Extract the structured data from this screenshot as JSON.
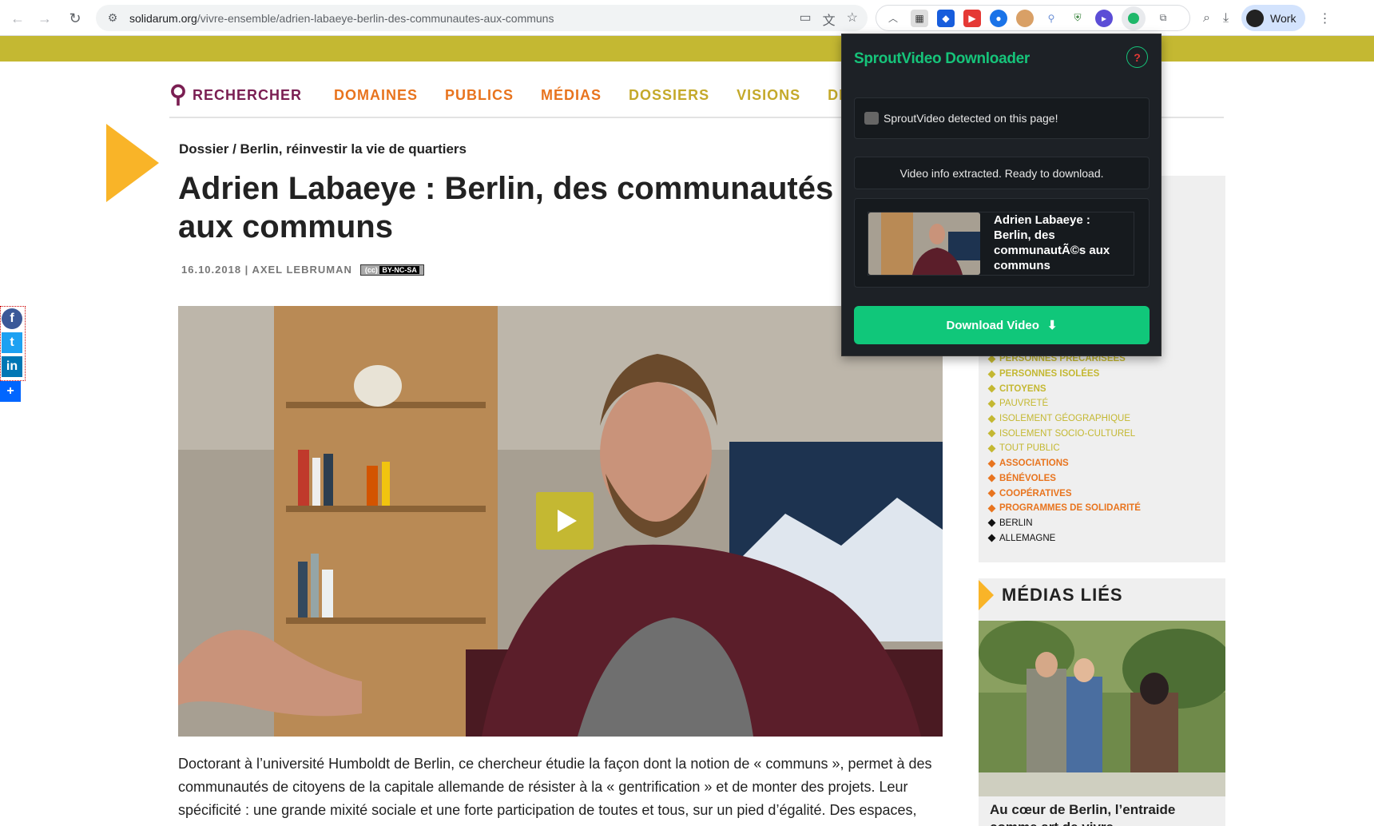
{
  "browser": {
    "url_host": "solidarum.org",
    "url_path": "/vivre-ensemble/adrien-labaeye-berlin-des-communautes-aux-communs",
    "profile_label": "Work"
  },
  "nav": {
    "search_label": "RECHERCHER",
    "items": [
      {
        "label": "DOMAINES",
        "color": "#e8741e"
      },
      {
        "label": "PUBLICS",
        "color": "#e8741e"
      },
      {
        "label": "MÉDIAS",
        "color": "#e8741e"
      },
      {
        "label": "DOSSIERS",
        "color": "#c4a92a"
      },
      {
        "label": "VISIONS",
        "color": "#c4a92a"
      },
      {
        "label": "DISCU",
        "color": "#c4a92a"
      }
    ]
  },
  "article": {
    "breadcrumb": "Dossier / Berlin, réinvestir la vie de quartiers",
    "title": "Adrien Labaeye : Berlin, des communautés aux communs",
    "meta": "16.10.2018 | AXEL LEBRUMAN",
    "license": "BY-NC-SA",
    "paragraph": "Doctorant à l’université Humboldt de Berlin, ce chercheur étudie la façon dont la notion de  « communs », permet à des communautés de citoyens de la capitale allemande de résister à la « gentrification » et de monter des projets. Leur spécificité : une grande mixité sociale et une forte participation de toutes et tous, sur un pied d’égalité. Des espaces,"
  },
  "sidebar": {
    "tags": [
      {
        "label": "PERSONNES PRÉCARISÉES",
        "color": "#c4b832",
        "bold": true
      },
      {
        "label": "PERSONNES ISOLÉES",
        "color": "#c4b832",
        "bold": true
      },
      {
        "label": "CITOYENS",
        "color": "#c4b832",
        "bold": true
      },
      {
        "label": "PAUVRETÉ",
        "color": "#c4b832",
        "bold": false
      },
      {
        "label": "ISOLEMENT GÉOGRAPHIQUE",
        "color": "#c4b832",
        "bold": false
      },
      {
        "label": "ISOLEMENT SOCIO-CULTUREL",
        "color": "#c4b832",
        "bold": false
      },
      {
        "label": "TOUT PUBLIC",
        "color": "#c4b832",
        "bold": false
      },
      {
        "label": "ASSOCIATIONS",
        "color": "#e8741e",
        "bold": true
      },
      {
        "label": "BÉNÉVOLES",
        "color": "#e8741e",
        "bold": true
      },
      {
        "label": "COOPÉRATIVES",
        "color": "#e8741e",
        "bold": true
      },
      {
        "label": "PROGRAMMES DE SOLIDARITÉ",
        "color": "#e8741e",
        "bold": true
      },
      {
        "label": "BERLIN",
        "color": "#111111",
        "bold": false
      },
      {
        "label": "ALLEMAGNE",
        "color": "#111111",
        "bold": false
      }
    ],
    "medias_title": "MÉDIAS LIÉS",
    "medias_caption": "Au cœur de Berlin, l’entraide comme art de vivre"
  },
  "popup": {
    "title": "SproutVideo Downloader",
    "help": "?",
    "detected": "SproutVideo detected on this page!",
    "status": "Video info extracted. Ready to download.",
    "video_title": "Adrien Labaeye : Berlin, des communautÃ©s aux communs",
    "download_label": "Download Video",
    "download_icon": "⬇"
  }
}
